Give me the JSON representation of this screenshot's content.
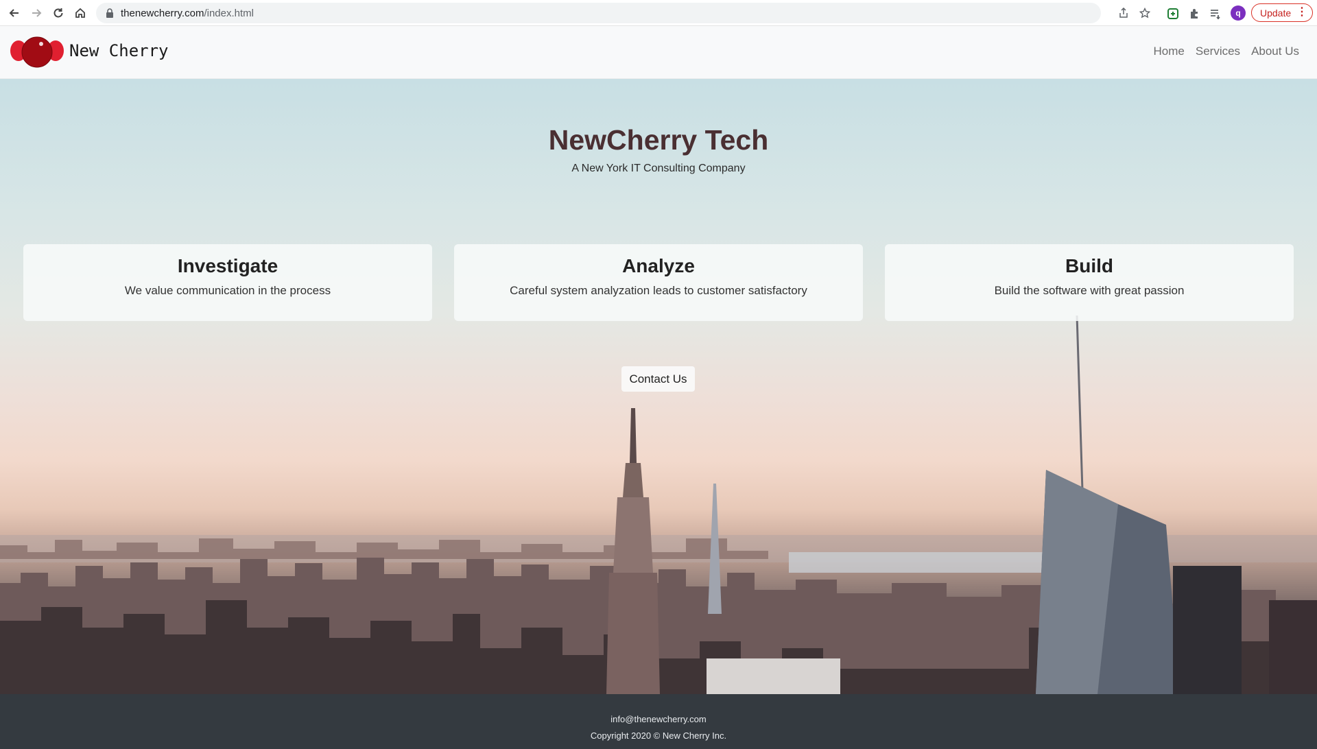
{
  "browser": {
    "url_host": "thenewcherry.com",
    "url_path": "/index.html",
    "profile_initial": "q",
    "update_label": "Update"
  },
  "site": {
    "brand": "New Cherry",
    "nav": [
      "Home",
      "Services",
      "About Us"
    ],
    "accent_color": "#c0151e"
  },
  "hero": {
    "title": "NewCherry Tech",
    "subtitle": "A New York IT Consulting Company",
    "cards": [
      {
        "title": "Investigate",
        "text": "We value communication in the process"
      },
      {
        "title": "Analyze",
        "text": "Careful system analyzation leads to customer satisfactory"
      },
      {
        "title": "Build",
        "text": "Build the software with great passion"
      }
    ],
    "contact_label": "Contact Us"
  },
  "footer": {
    "email": "info@thenewcherry.com",
    "copyright": "Copyright 2020 © New Cherry Inc."
  }
}
